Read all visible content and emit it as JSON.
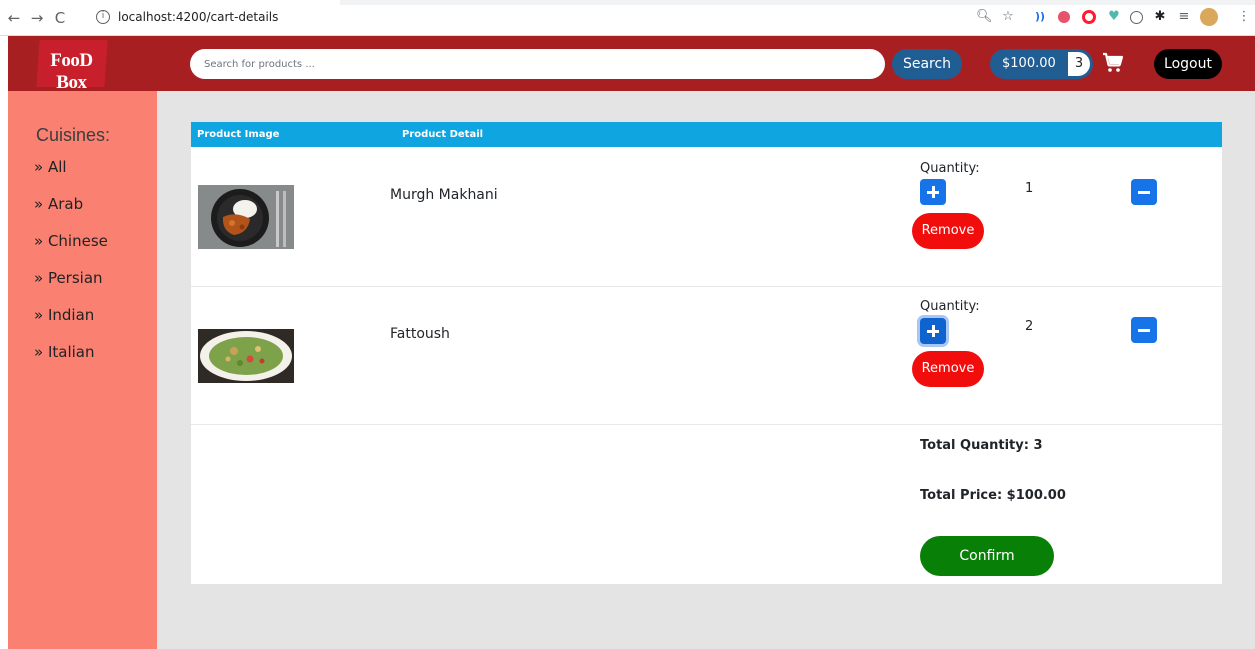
{
  "browser": {
    "back_glyph": "←",
    "forward_glyph": "→",
    "reload_glyph": "C",
    "info_glyph": "i",
    "url": "localhost:4200/cart-details",
    "icons": [
      "back-icon",
      "forward-icon",
      "reload-icon",
      "info-icon",
      "zoom-icon",
      "star-icon",
      "wave-extension-icon",
      "shield-extension-icon",
      "opera-extension-icon",
      "heart-extension-icon",
      "smile-extension-icon",
      "puzzle-extension-icon",
      "reading-list-icon",
      "profile-avatar",
      "kebab-menu-icon"
    ]
  },
  "header": {
    "logo_text": "FooD Box",
    "search_placeholder": "Search for products ...",
    "search_label": "Search",
    "cart_total": "$100.00",
    "cart_count": "3",
    "logout_label": "Logout",
    "colors": {
      "bar": "#a81f22",
      "pill": "#1f5d93",
      "logout": "#000000"
    }
  },
  "sidebar": {
    "title": "Cuisines:",
    "items": [
      "» All",
      "» Arab",
      "» Chinese",
      "» Persian",
      "» Indian",
      "» Italian"
    ],
    "color": "#fa8072"
  },
  "table": {
    "headers": [
      "Product Image",
      "Product Detail"
    ],
    "quantity_label": "Quantity:",
    "remove_label": "Remove",
    "rows": [
      {
        "name": "Murgh Makhani",
        "quantity": "1"
      },
      {
        "name": "Fattoush",
        "quantity": "2"
      }
    ],
    "total_quantity": "Total Quantity: 3",
    "total_price": "Total Price: $100.00",
    "confirm_label": "Confirm",
    "colors": {
      "header": "#0ea5e1",
      "qty_button": "#1774e8",
      "remove": "#f20d0d",
      "confirm": "#088008"
    }
  }
}
